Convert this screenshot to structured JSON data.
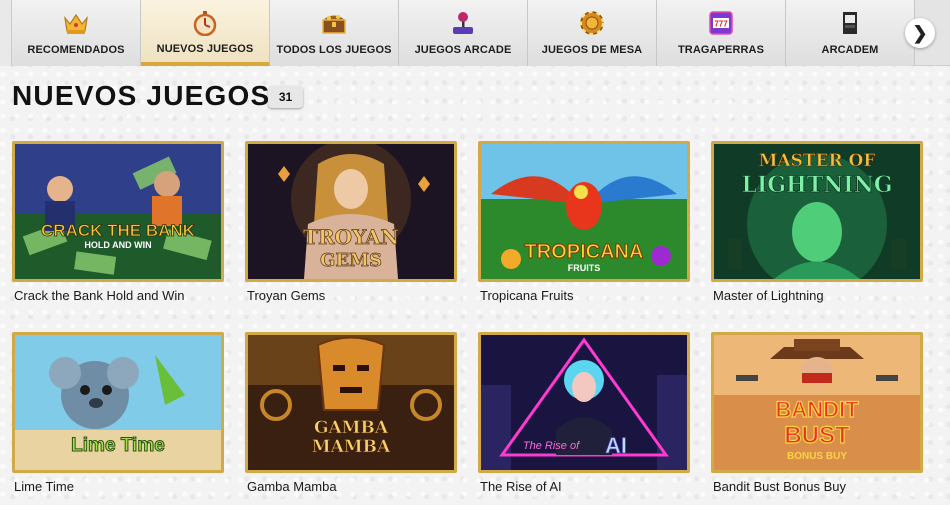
{
  "nav": {
    "tabs": [
      {
        "label": "RECOMENDADOS",
        "icon": "crown-icon",
        "active": false
      },
      {
        "label": "NUEVOS JUEGOS",
        "icon": "stopwatch-icon",
        "active": true
      },
      {
        "label": "TODOS LOS JUEGOS",
        "icon": "treasure-chest-icon",
        "active": false
      },
      {
        "label": "JUEGOS ARCADE",
        "icon": "joystick-icon",
        "active": false
      },
      {
        "label": "JUEGOS DE MESA",
        "icon": "poker-chip-icon",
        "active": false
      },
      {
        "label": "TRAGAPERRAS",
        "icon": "slot-machine-icon",
        "active": false
      },
      {
        "label": "ARCADEM",
        "icon": "arcade-cabinet-icon",
        "active": false
      }
    ],
    "next_glyph": "❯"
  },
  "section": {
    "title": "NUEVOS JUEGOS",
    "count": "31"
  },
  "games": [
    {
      "title": "Crack the Bank Hold and Win",
      "art_line1": "CRACK THE BANK",
      "art_line2": "HOLD AND WIN"
    },
    {
      "title": "Troyan Gems",
      "art_line1": "TROYAN",
      "art_line2": "GEMS"
    },
    {
      "title": "Tropicana Fruits",
      "art_line1": "TROPICANA",
      "art_line2": "FRUITS"
    },
    {
      "title": "Master of Lightning",
      "art_line1": "MASTER OF",
      "art_line2": "LIGHTNING"
    },
    {
      "title": "Lime Time",
      "art_line1": "Lime Time",
      "art_line2": ""
    },
    {
      "title": "Gamba Mamba",
      "art_line1": "GAMBA",
      "art_line2": "MAMBA"
    },
    {
      "title": "The Rise of AI",
      "art_line1": "The Rise of",
      "art_line2": "AI"
    },
    {
      "title": "Bandit Bust Bonus Buy",
      "art_line1": "BANDIT",
      "art_line2": "BUST",
      "art_line3": "BONUS BUY"
    }
  ]
}
